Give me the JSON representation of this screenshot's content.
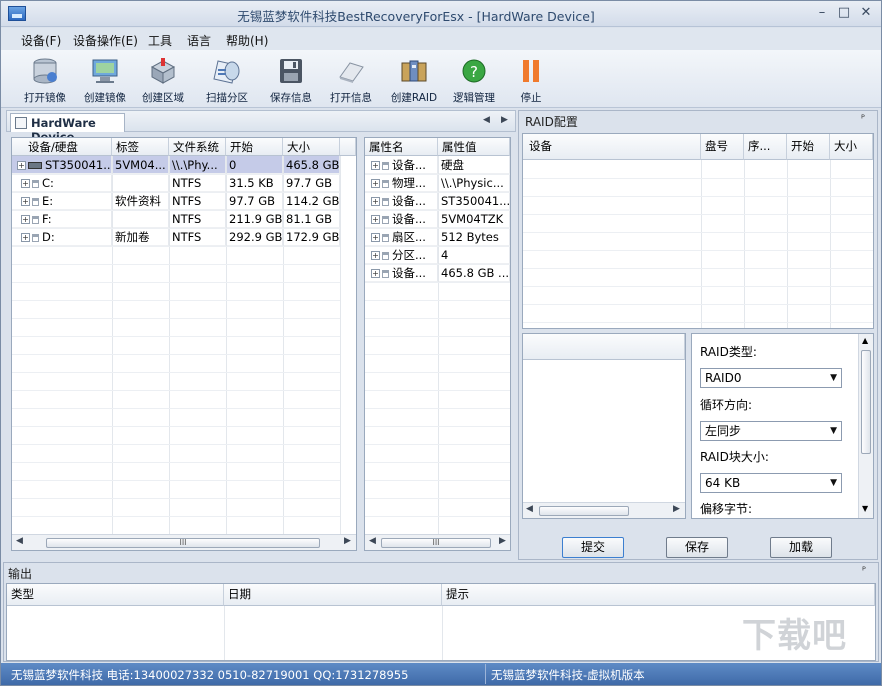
{
  "window": {
    "title": "无锡蓝梦软件科技BestRecoveryForEsx - [HardWare Device]",
    "controls": {
      "minimize": "–",
      "restore": "□",
      "close": "✕"
    }
  },
  "menu": [
    "设备(F)",
    "设备操作(E)",
    "工具",
    "语言",
    "帮助(H)"
  ],
  "toolbar": [
    {
      "label": "打开镜像",
      "icon": "open-image-icon"
    },
    {
      "label": "创建镜像",
      "icon": "create-image-icon"
    },
    {
      "label": "创建区域",
      "icon": "create-region-icon"
    },
    {
      "label": "扫描分区",
      "icon": "scan-partition-icon"
    },
    {
      "label": "保存信息",
      "icon": "save-info-icon"
    },
    {
      "label": "打开信息",
      "icon": "open-info-icon"
    },
    {
      "label": "创建RAID",
      "icon": "create-raid-icon"
    },
    {
      "label": "逻辑管理",
      "icon": "logic-manage-icon"
    },
    {
      "label": "停止",
      "icon": "stop-icon"
    }
  ],
  "device_tab": {
    "label": "HardWare Device",
    "nav_prev": "◀",
    "nav_next": "▶"
  },
  "device_table": {
    "columns": [
      "设备/硬盘",
      "标签",
      "文件系统",
      "开始",
      "大小"
    ],
    "rows": [
      {
        "name": "ST350041...",
        "label": "5VM04...",
        "fs": "\\\\.\\Phy...",
        "start": "0",
        "size": "465.8 GB",
        "selected": true
      },
      {
        "name": "C:",
        "label": "",
        "fs": "NTFS",
        "start": "31.5 KB",
        "size": "97.7 GB"
      },
      {
        "name": "E:",
        "label": "软件资料",
        "fs": "NTFS",
        "start": "97.7 GB",
        "size": "114.2 GB"
      },
      {
        "name": "F:",
        "label": "",
        "fs": "NTFS",
        "start": "211.9 GB",
        "size": "81.1 GB"
      },
      {
        "name": "D:",
        "label": "新加卷",
        "fs": "NTFS",
        "start": "292.9 GB",
        "size": "172.9 GB"
      }
    ]
  },
  "property_table": {
    "columns": [
      "属性名",
      "属性值"
    ],
    "rows": [
      {
        "name": "设备...",
        "value": "硬盘"
      },
      {
        "name": "物理...",
        "value": "\\\\.\\Physic..."
      },
      {
        "name": "设备...",
        "value": "ST350041..."
      },
      {
        "name": "设备...",
        "value": "5VM04TZK"
      },
      {
        "name": "扇区...",
        "value": "512 Bytes"
      },
      {
        "name": "分区...",
        "value": "4"
      },
      {
        "name": "设备...",
        "value": "465.8 GB ..."
      }
    ]
  },
  "raid": {
    "title": "RAID配置",
    "pin": "ᴾ",
    "columns": [
      "设备",
      "盘号",
      "序...",
      "开始",
      "大小"
    ],
    "type_label": "RAID类型:",
    "type_value": "RAID0",
    "direction_label": "循环方向:",
    "direction_value": "左同步",
    "block_label": "RAID块大小:",
    "block_value": "64 KB",
    "offset_label": "偏移字节:",
    "buttons": {
      "submit": "提交",
      "save": "保存",
      "load": "加载"
    }
  },
  "output": {
    "title": "输出",
    "columns": [
      "类型",
      "日期",
      "提示"
    ]
  },
  "status": {
    "left": "无锡蓝梦软件科技 电话:13400027332 0510-82719001 QQ:1731278955",
    "right": "无锡蓝梦软件科技-虚拟机版本"
  },
  "scroll_thumb": "III",
  "watermark": "下载吧"
}
